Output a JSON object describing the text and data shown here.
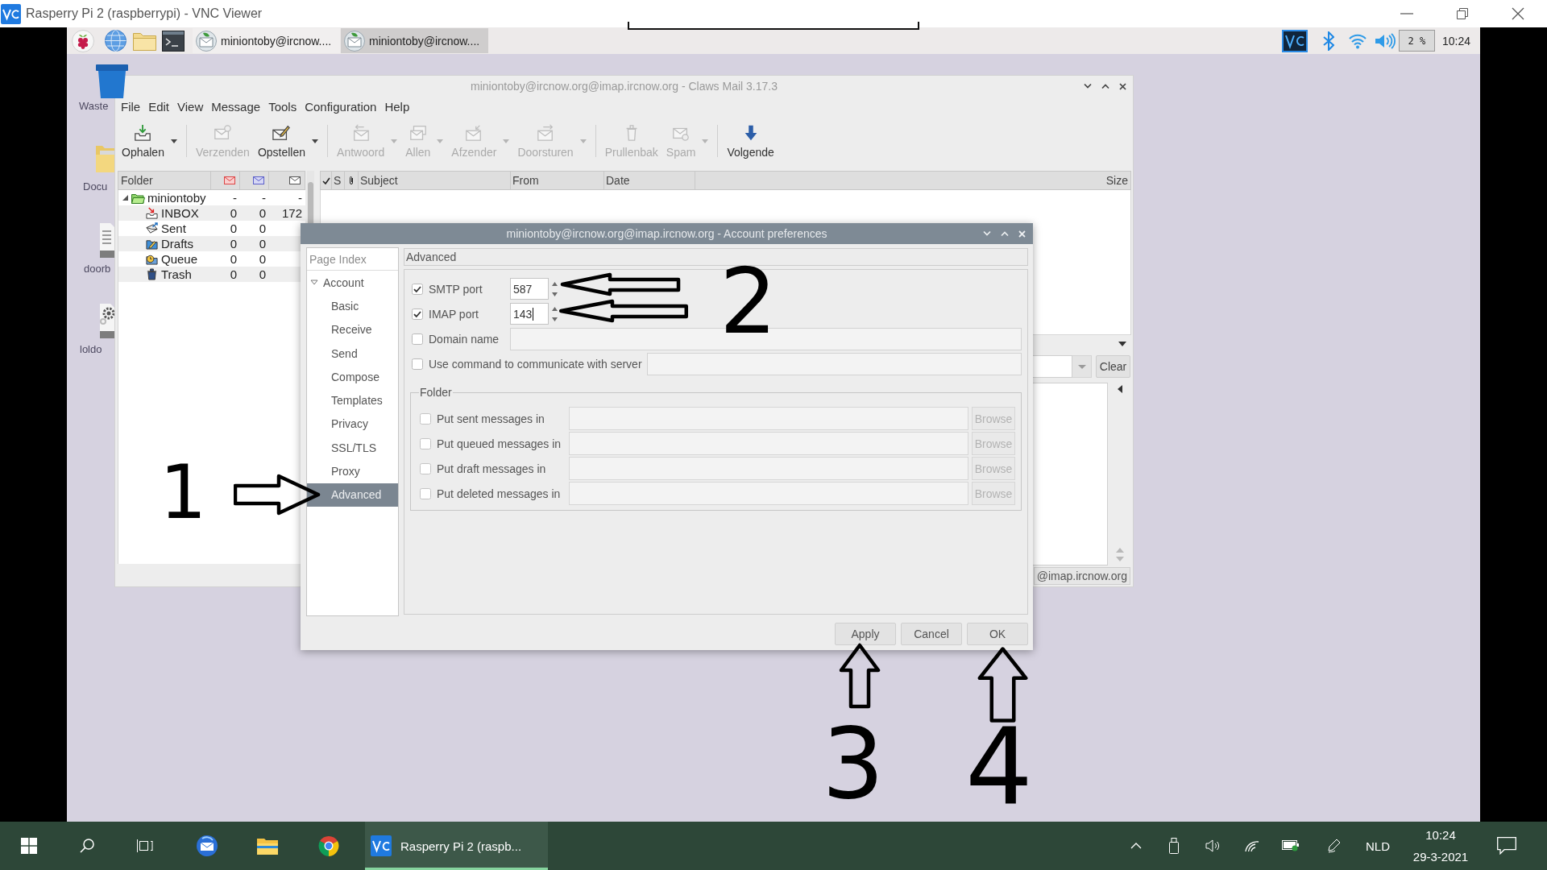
{
  "vnc_window": {
    "title": "Rasperry Pi 2 (raspberrypi) - VNC Viewer"
  },
  "pi_panel": {
    "tasks": [
      {
        "label": "miniontoby@ircnow....",
        "selected": false
      },
      {
        "label": "miniontoby@ircnow....",
        "selected": true
      }
    ],
    "cpu": "2 %",
    "clock": "10:24"
  },
  "desktop_icons": [
    {
      "label": "Waste"
    },
    {
      "label": "Docu"
    },
    {
      "label": "doorb"
    },
    {
      "label": "loldo"
    }
  ],
  "claws_window": {
    "title": "miniontoby@ircnow.org@imap.ircnow.org - Claws Mail 3.17.3",
    "menu": [
      "File",
      "Edit",
      "View",
      "Message",
      "Tools",
      "Configuration",
      "Help"
    ],
    "toolbar": [
      [
        {
          "label": "Ophalen",
          "disabled": false,
          "dropdown": true
        }
      ],
      [
        {
          "label": "Verzenden",
          "disabled": true,
          "dropdown": false
        },
        {
          "label": "Opstellen",
          "disabled": false,
          "dropdown": true
        }
      ],
      [
        {
          "label": "Antwoord",
          "disabled": true,
          "dropdown": true
        },
        {
          "label": "Allen",
          "disabled": true,
          "dropdown": true
        },
        {
          "label": "Afzender",
          "disabled": true,
          "dropdown": true
        },
        {
          "label": "Doorsturen",
          "disabled": true,
          "dropdown": true
        }
      ],
      [
        {
          "label": "Prullenbak",
          "disabled": true,
          "dropdown": false
        },
        {
          "label": "Spam",
          "disabled": true,
          "dropdown": true
        }
      ],
      [
        {
          "label": "Volgende",
          "disabled": false,
          "dropdown": false
        }
      ]
    ],
    "folder_tree": {
      "header": "Folder",
      "folders": [
        {
          "name": "miniontoby",
          "unread": "-",
          "new": "-",
          "total": "-",
          "expanded": true,
          "children": [
            {
              "name": "INBOX",
              "unread": "0",
              "new": "0",
              "total": "172"
            },
            {
              "name": "Sent",
              "unread": "0",
              "new": "0"
            },
            {
              "name": "Drafts",
              "unread": "0",
              "new": "0"
            },
            {
              "name": "Queue",
              "unread": "0",
              "new": "0"
            },
            {
              "name": "Trash",
              "unread": "0",
              "new": "0"
            }
          ]
        }
      ]
    },
    "message_list": {
      "columns": [
        "S",
        "Subject",
        "From",
        "Date",
        "Size"
      ]
    },
    "quick_search": {
      "button": "Clear"
    },
    "status_bar": "@imap.ircnow.org"
  },
  "dialog": {
    "title": "miniontoby@ircnow.org@imap.ircnow.org - Account preferences",
    "page_index": {
      "header": "Page Index",
      "items": [
        {
          "label": "Account",
          "expanded": true,
          "selected": false,
          "children": [
            {
              "label": "Basic",
              "selected": false
            },
            {
              "label": "Receive",
              "selected": false
            },
            {
              "label": "Send",
              "selected": false
            },
            {
              "label": "Compose",
              "selected": false
            },
            {
              "label": "Templates",
              "selected": false
            },
            {
              "label": "Privacy",
              "selected": false
            },
            {
              "label": "SSL/TLS",
              "selected": false
            },
            {
              "label": "Proxy",
              "selected": false
            },
            {
              "label": "Advanced",
              "selected": true
            }
          ]
        }
      ]
    },
    "section": "Advanced",
    "settings": [
      {
        "kind": "spin",
        "label": "SMTP port",
        "checked": true,
        "value": "587",
        "focused": false
      },
      {
        "kind": "spin",
        "label": "IMAP port",
        "checked": true,
        "value": "143",
        "focused": true
      },
      {
        "kind": "entry",
        "label": "Domain name",
        "checked": false,
        "focused": false
      },
      {
        "kind": "entry",
        "label": "Use command to communicate with server",
        "checked": false,
        "focused": false
      }
    ],
    "folder_group": {
      "legend": "Folder",
      "rows": [
        {
          "label": "Put sent messages in",
          "checked": false,
          "button": "Browse"
        },
        {
          "label": "Put queued messages in",
          "checked": false,
          "button": "Browse"
        },
        {
          "label": "Put draft messages in",
          "checked": false,
          "button": "Browse"
        },
        {
          "label": "Put deleted messages in",
          "checked": false,
          "button": "Browse"
        }
      ]
    },
    "buttons": [
      "Apply",
      "Cancel",
      "OK"
    ]
  },
  "annotations": [
    {
      "kind": "number",
      "text": "1"
    },
    {
      "kind": "arrowright"
    },
    {
      "kind": "arrowleft"
    },
    {
      "kind": "arrowleft"
    },
    {
      "kind": "number",
      "text": "2"
    },
    {
      "kind": "arrowup"
    },
    {
      "kind": "number",
      "text": "3"
    },
    {
      "kind": "arrowup"
    },
    {
      "kind": "number",
      "text": "4"
    }
  ],
  "windows_taskbar": {
    "apps": [
      {
        "label": "Rasperry Pi 2 (raspb...",
        "selected": true
      }
    ],
    "language": "NLD",
    "time": "10:24",
    "date": "29-3-2021"
  }
}
